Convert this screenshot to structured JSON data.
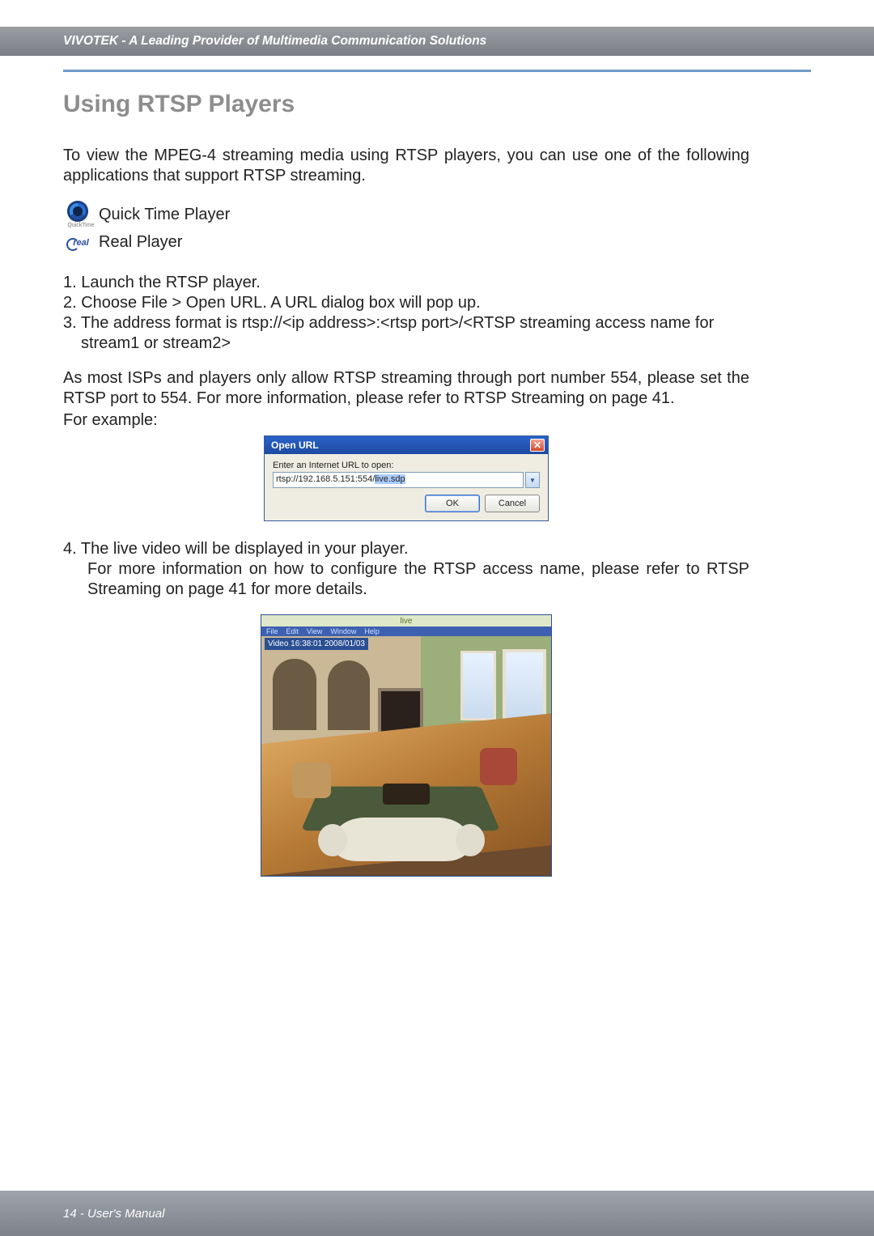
{
  "header": {
    "text": "VIVOTEK - A Leading Provider of Multimedia Communication Solutions"
  },
  "title": "Using RTSP Players",
  "intro": "To view the MPEG-4 streaming media using RTSP players, you can use one of the following applications that support RTSP streaming.",
  "players": {
    "quicktime": "Quick Time Player",
    "qt_caption": "QuickTime",
    "real": "Real Player",
    "real_label": "real"
  },
  "steps": {
    "s1": "1. Launch the RTSP player.",
    "s2": "2. Choose File > Open URL. A URL dialog box will pop up.",
    "s3": "3. The address format is rtsp://<ip address>:<rtsp port>/<RTSP streaming access name for",
    "s3b": "stream1 or stream2>"
  },
  "note": "As most ISPs and players only allow RTSP streaming through port number 554, please set the RTSP port to 554. For more information, please refer to RTSP Streaming on page 41.",
  "example_label": "For example:",
  "dialog": {
    "title": "Open URL",
    "label": "Enter an Internet URL to open:",
    "url_plain": "rtsp://192.168.5.151:554/",
    "url_highlight": "live.sdp",
    "ok": "OK",
    "cancel": "Cancel",
    "dd": "▼"
  },
  "step4": {
    "line1": "4. The live video will be displayed in your player.",
    "line2": "For more information on how to configure the RTSP access name, please refer to RTSP Streaming on page 41 for more details."
  },
  "player_window": {
    "top": "live",
    "menus": [
      "File",
      "Edit",
      "View",
      "Window",
      "Help"
    ],
    "timestamp": "Video 16:38:01 2008/01/03"
  },
  "footer": "14 - User's Manual"
}
